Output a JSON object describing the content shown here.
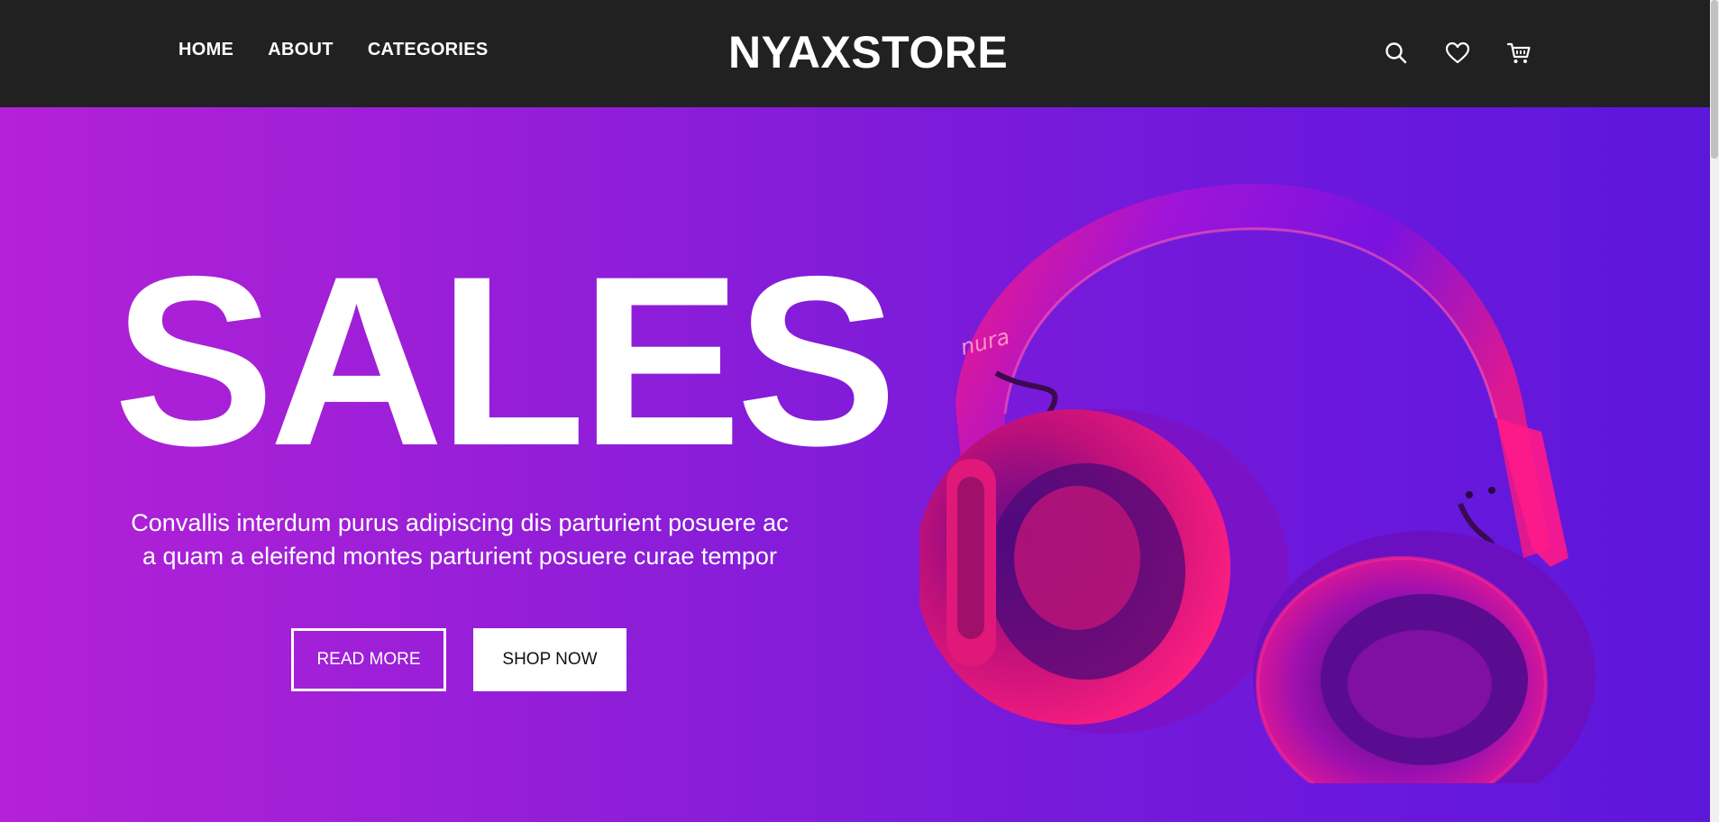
{
  "nav": {
    "links": [
      "HOME",
      "ABOUT",
      "CATEGORIES"
    ],
    "brand": "NYAXSTORE",
    "icons": [
      "search-icon",
      "heart-icon",
      "cart-icon"
    ]
  },
  "hero": {
    "title": "SALES",
    "description": "Convallis interdum purus adipiscing dis parturient posuere ac a quam a eleifend montes parturient posuere curae tempor",
    "read_more": "READ MORE",
    "shop_now": "SHOP NOW",
    "product_brand": "nura",
    "gradient_start": "#b421d6",
    "gradient_end": "#5d17db",
    "product_color": "#ff1a8c"
  },
  "colors": {
    "navbar_bg": "#212121",
    "text_light": "#ffffff"
  }
}
